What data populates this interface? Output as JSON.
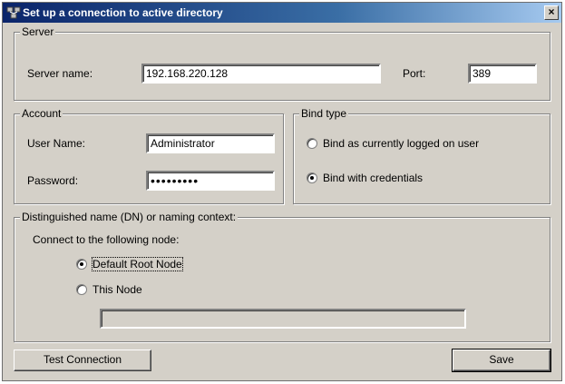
{
  "window": {
    "title": "Set up a connection to active directory",
    "close_label": "×"
  },
  "server": {
    "legend": "Server",
    "server_name_label": "Server name:",
    "server_name_value": "192.168.220.128",
    "port_label": "Port:",
    "port_value": "389"
  },
  "account": {
    "legend": "Account",
    "username_label": "User Name:",
    "username_value": "Administrator",
    "password_label": "Password:",
    "password_value": "•••••••••"
  },
  "bind_type": {
    "legend": "Bind type",
    "options": [
      {
        "label": "Bind as currently logged on user",
        "checked": false
      },
      {
        "label": "Bind with credentials",
        "checked": true
      }
    ]
  },
  "dn": {
    "legend": "Distinguished name (DN) or naming context:",
    "connect_label": "Connect to the following node:",
    "options": [
      {
        "label": "Default Root Node",
        "checked": true
      },
      {
        "label": "This Node",
        "checked": false
      }
    ],
    "node_value": ""
  },
  "buttons": {
    "test_connection": "Test Connection",
    "save": "Save"
  },
  "colors": {
    "face": "#d4d0c8",
    "title_start": "#0a246a",
    "title_end": "#a6caf0"
  }
}
